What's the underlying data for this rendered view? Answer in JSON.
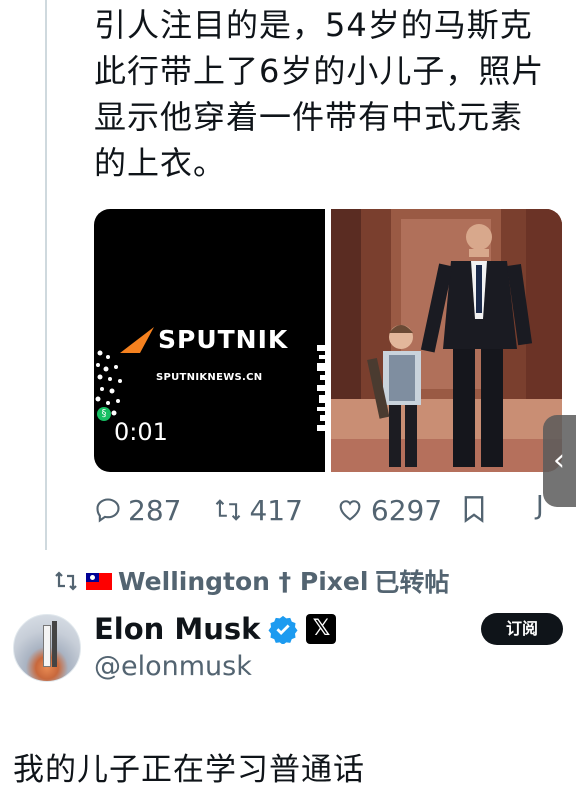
{
  "post": {
    "text_lines": [
      "引人注目的是，54岁的马斯克",
      "此行带上了6岁的小儿子，照片",
      "显示他穿着一件带有中式元素",
      "的上衣。"
    ]
  },
  "media": {
    "video": {
      "brand": "SPUTNIK",
      "url_text": "SPUTNIKNEWS.CN",
      "duration": "0:01"
    }
  },
  "actions": {
    "replies": "287",
    "reposts": "417",
    "likes": "6297",
    "share_fragment": "J"
  },
  "repost_banner": {
    "user": "Wellington † Pixel",
    "suffix": "已转帖"
  },
  "tweet": {
    "display_name": "Elon Musk",
    "handle": "@elonmusk",
    "subscribe_label": "订阅",
    "x_badge": "𝕏",
    "body": "我的儿子正在学习普通话"
  },
  "icons": {
    "reply": "reply-icon",
    "repost": "repost-icon",
    "like": "heart-icon",
    "bookmark": "bookmark-icon",
    "verified": "verified-badge-icon",
    "side_arrow": "chevron-left-icon"
  },
  "colors": {
    "text": "#0f1419",
    "muted": "#536471",
    "verified_blue": "#1d9bf0",
    "sputnik_orange": "#f5811f"
  }
}
